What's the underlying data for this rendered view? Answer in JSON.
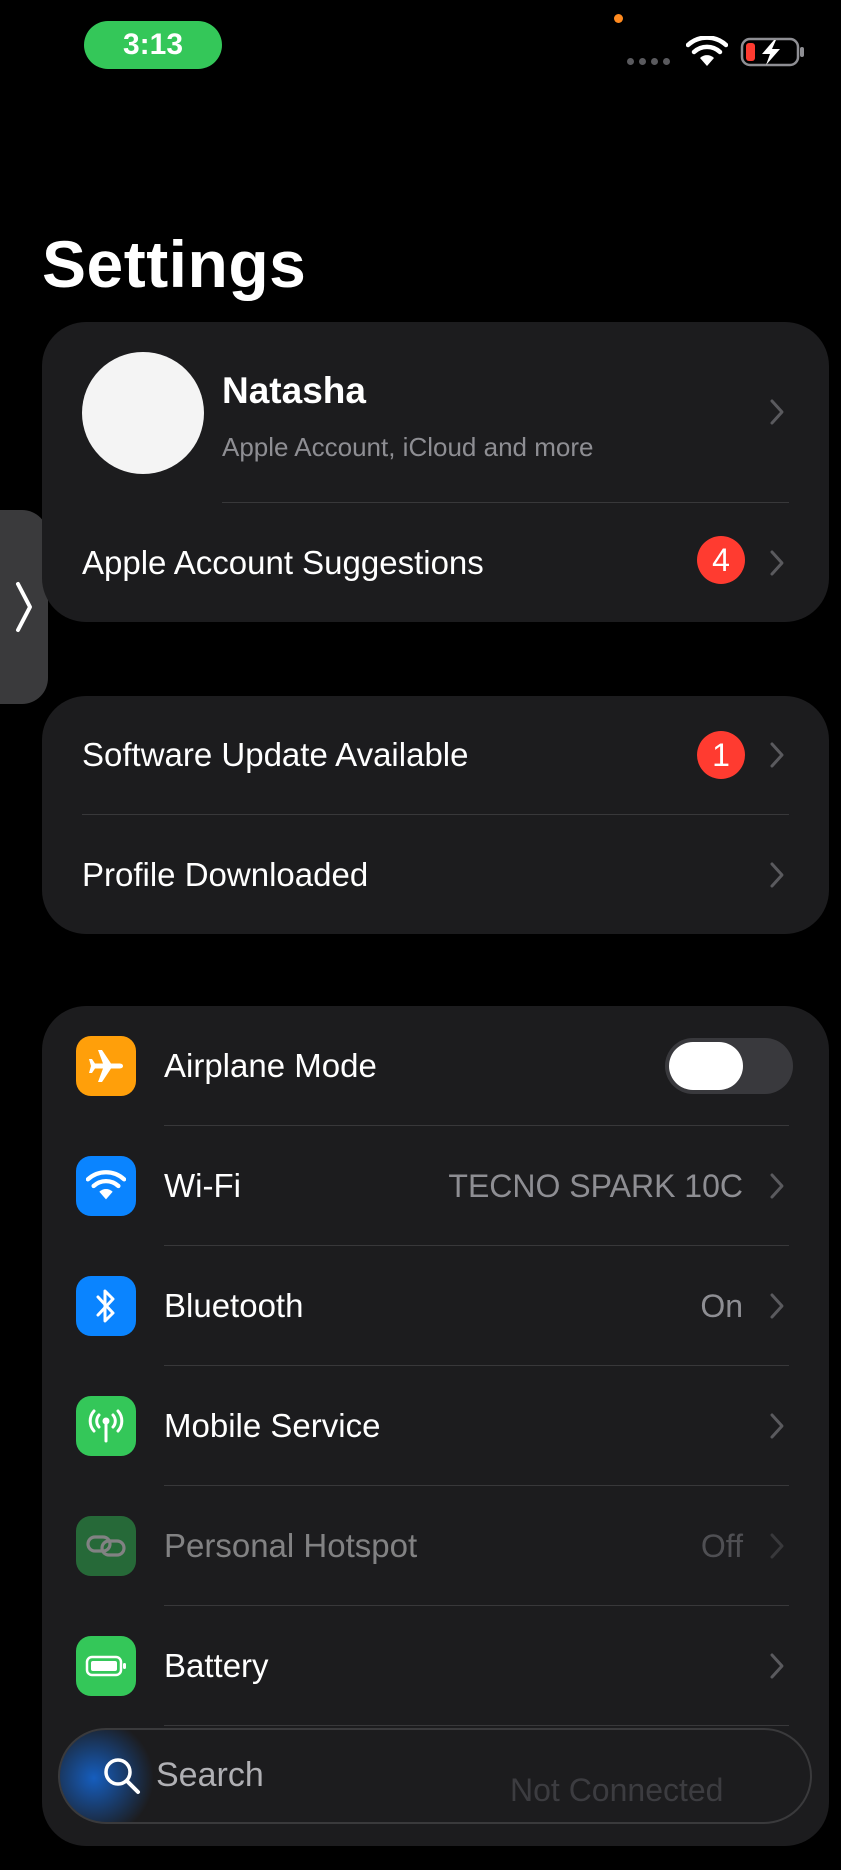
{
  "status_bar": {
    "time": "3:13"
  },
  "page": {
    "title": "Settings"
  },
  "profile": {
    "name": "Natasha",
    "subtitle": "Apple Account, iCloud and more",
    "suggestions_label": "Apple Account Suggestions",
    "suggestions_badge": "4"
  },
  "notices": {
    "software_update_label": "Software Update Available",
    "software_update_badge": "1",
    "profile_downloaded_label": "Profile Downloaded"
  },
  "connectivity": {
    "airplane_mode": {
      "label": "Airplane Mode",
      "on": false
    },
    "wifi": {
      "label": "Wi-Fi",
      "value": "TECNO SPARK 10C"
    },
    "bluetooth": {
      "label": "Bluetooth",
      "value": "On"
    },
    "mobile_service": {
      "label": "Mobile Service"
    },
    "personal_hotspot": {
      "label": "Personal Hotspot",
      "value": "Off"
    },
    "battery": {
      "label": "Battery"
    }
  },
  "search": {
    "placeholder": "Search",
    "behind_value": "Not Connected"
  },
  "colors": {
    "background": "#000000",
    "group_bg": "#1c1c1e",
    "badge": "#ff3b30",
    "airplane_icon": "#ff9f0a",
    "wifi_icon": "#0a84ff",
    "bluetooth_icon": "#0a84ff",
    "mobile_icon": "#34c759",
    "hotspot_icon": "#34c759",
    "battery_icon": "#34c759"
  }
}
